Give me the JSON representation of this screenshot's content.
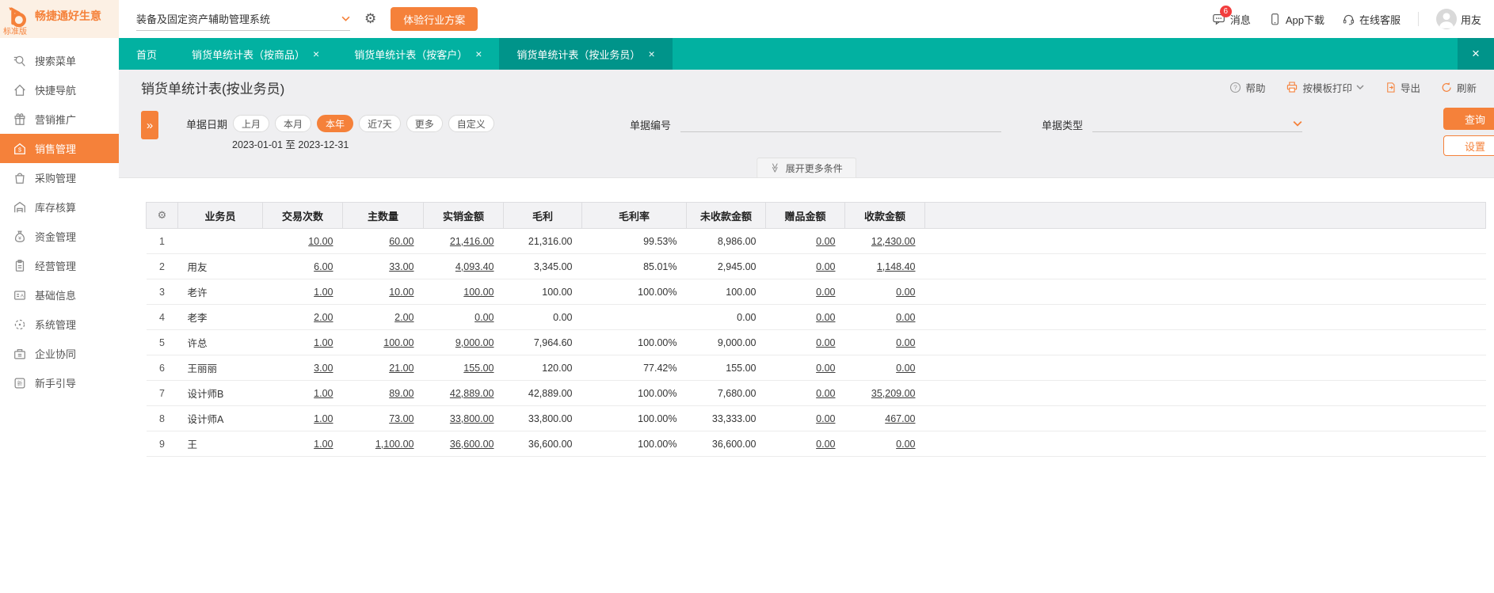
{
  "colors": {
    "accent": "#f5813a",
    "teal": "#02b1a1",
    "teal_dark": "#00948a"
  },
  "topbar": {
    "logo_title": "畅捷通好生意",
    "logo_edition": "标准版",
    "system_select": "装备及固定资产辅助管理系统",
    "trial_button": "体验行业方案",
    "messages_label": "消息",
    "messages_badge": "6",
    "app_download_label": "App下载",
    "online_service_label": "在线客服",
    "username": "用友"
  },
  "tabbar": {
    "tabs": [
      {
        "label": "首页",
        "closable": false,
        "active": false
      },
      {
        "label": "销货单统计表（按商品）",
        "closable": true,
        "active": false
      },
      {
        "label": "销货单统计表（按客户）",
        "closable": true,
        "active": false
      },
      {
        "label": "销货单统计表（按业务员）",
        "closable": true,
        "active": true
      }
    ],
    "close_all": "×"
  },
  "sidebar": {
    "items": [
      {
        "label": "搜索菜单",
        "icon": "search-icon",
        "active": false
      },
      {
        "label": "快捷导航",
        "icon": "home-icon",
        "active": false
      },
      {
        "label": "营销推广",
        "icon": "gift-icon",
        "active": false
      },
      {
        "label": "销售管理",
        "icon": "sales-icon",
        "active": true
      },
      {
        "label": "采购管理",
        "icon": "shopping-bag-icon",
        "active": false
      },
      {
        "label": "库存核算",
        "icon": "warehouse-icon",
        "active": false
      },
      {
        "label": "资金管理",
        "icon": "money-bag-icon",
        "active": false
      },
      {
        "label": "经营管理",
        "icon": "clipboard-icon",
        "active": false
      },
      {
        "label": "基础信息",
        "icon": "id-card-icon",
        "active": false
      },
      {
        "label": "系统管理",
        "icon": "system-icon",
        "active": false
      },
      {
        "label": "企业协同",
        "icon": "briefcase-icon",
        "active": false
      },
      {
        "label": "新手引导",
        "icon": "guide-icon",
        "active": false
      }
    ]
  },
  "page": {
    "title": "销货单统计表(按业务员)",
    "toolbar": {
      "help": "帮助",
      "print": "按模板打印",
      "export": "导出",
      "refresh": "刷新"
    }
  },
  "filters": {
    "date_label": "单据日期",
    "date_options": [
      "上月",
      "本月",
      "本年",
      "近7天",
      "更多",
      "自定义"
    ],
    "date_selected": "本年",
    "date_range": "2023-01-01 至 2023-12-31",
    "doc_no_label": "单据编号",
    "doc_type_label": "单据类型",
    "query_button": "查询",
    "settings_button": "设置",
    "expand_more": "展开更多条件"
  },
  "table": {
    "columns": [
      {
        "label": "业务员",
        "link": false
      },
      {
        "label": "交易次数",
        "link": true
      },
      {
        "label": "主数量",
        "link": true
      },
      {
        "label": "实销金额",
        "link": true
      },
      {
        "label": "毛利",
        "link": false
      },
      {
        "label": "毛利率",
        "link": false
      },
      {
        "label": "未收款金额",
        "link": false
      },
      {
        "label": "赠品金额",
        "link": true
      },
      {
        "label": "收款金额",
        "link": true
      }
    ],
    "rows": [
      {
        "index": "1",
        "cells": [
          "",
          "10.00",
          "60.00",
          "21,416.00",
          "21,316.00",
          "99.53%",
          "8,986.00",
          "0.00",
          "12,430.00"
        ]
      },
      {
        "index": "2",
        "cells": [
          "用友",
          "6.00",
          "33.00",
          "4,093.40",
          "3,345.00",
          "85.01%",
          "2,945.00",
          "0.00",
          "1,148.40"
        ]
      },
      {
        "index": "3",
        "cells": [
          "老许",
          "1.00",
          "10.00",
          "100.00",
          "100.00",
          "100.00%",
          "100.00",
          "0.00",
          "0.00"
        ]
      },
      {
        "index": "4",
        "cells": [
          "老李",
          "2.00",
          "2.00",
          "0.00",
          "0.00",
          "",
          "0.00",
          "0.00",
          "0.00"
        ]
      },
      {
        "index": "5",
        "cells": [
          "许总",
          "1.00",
          "100.00",
          "9,000.00",
          "7,964.60",
          "100.00%",
          "9,000.00",
          "0.00",
          "0.00"
        ]
      },
      {
        "index": "6",
        "cells": [
          "王丽丽",
          "3.00",
          "21.00",
          "155.00",
          "120.00",
          "77.42%",
          "155.00",
          "0.00",
          "0.00"
        ]
      },
      {
        "index": "7",
        "cells": [
          "设计师B",
          "1.00",
          "89.00",
          "42,889.00",
          "42,889.00",
          "100.00%",
          "7,680.00",
          "0.00",
          "35,209.00"
        ]
      },
      {
        "index": "8",
        "cells": [
          "设计师A",
          "1.00",
          "73.00",
          "33,800.00",
          "33,800.00",
          "100.00%",
          "33,333.00",
          "0.00",
          "467.00"
        ]
      },
      {
        "index": "9",
        "cells": [
          "王",
          "1.00",
          "1,100.00",
          "36,600.00",
          "36,600.00",
          "100.00%",
          "36,600.00",
          "0.00",
          "0.00"
        ]
      }
    ]
  }
}
